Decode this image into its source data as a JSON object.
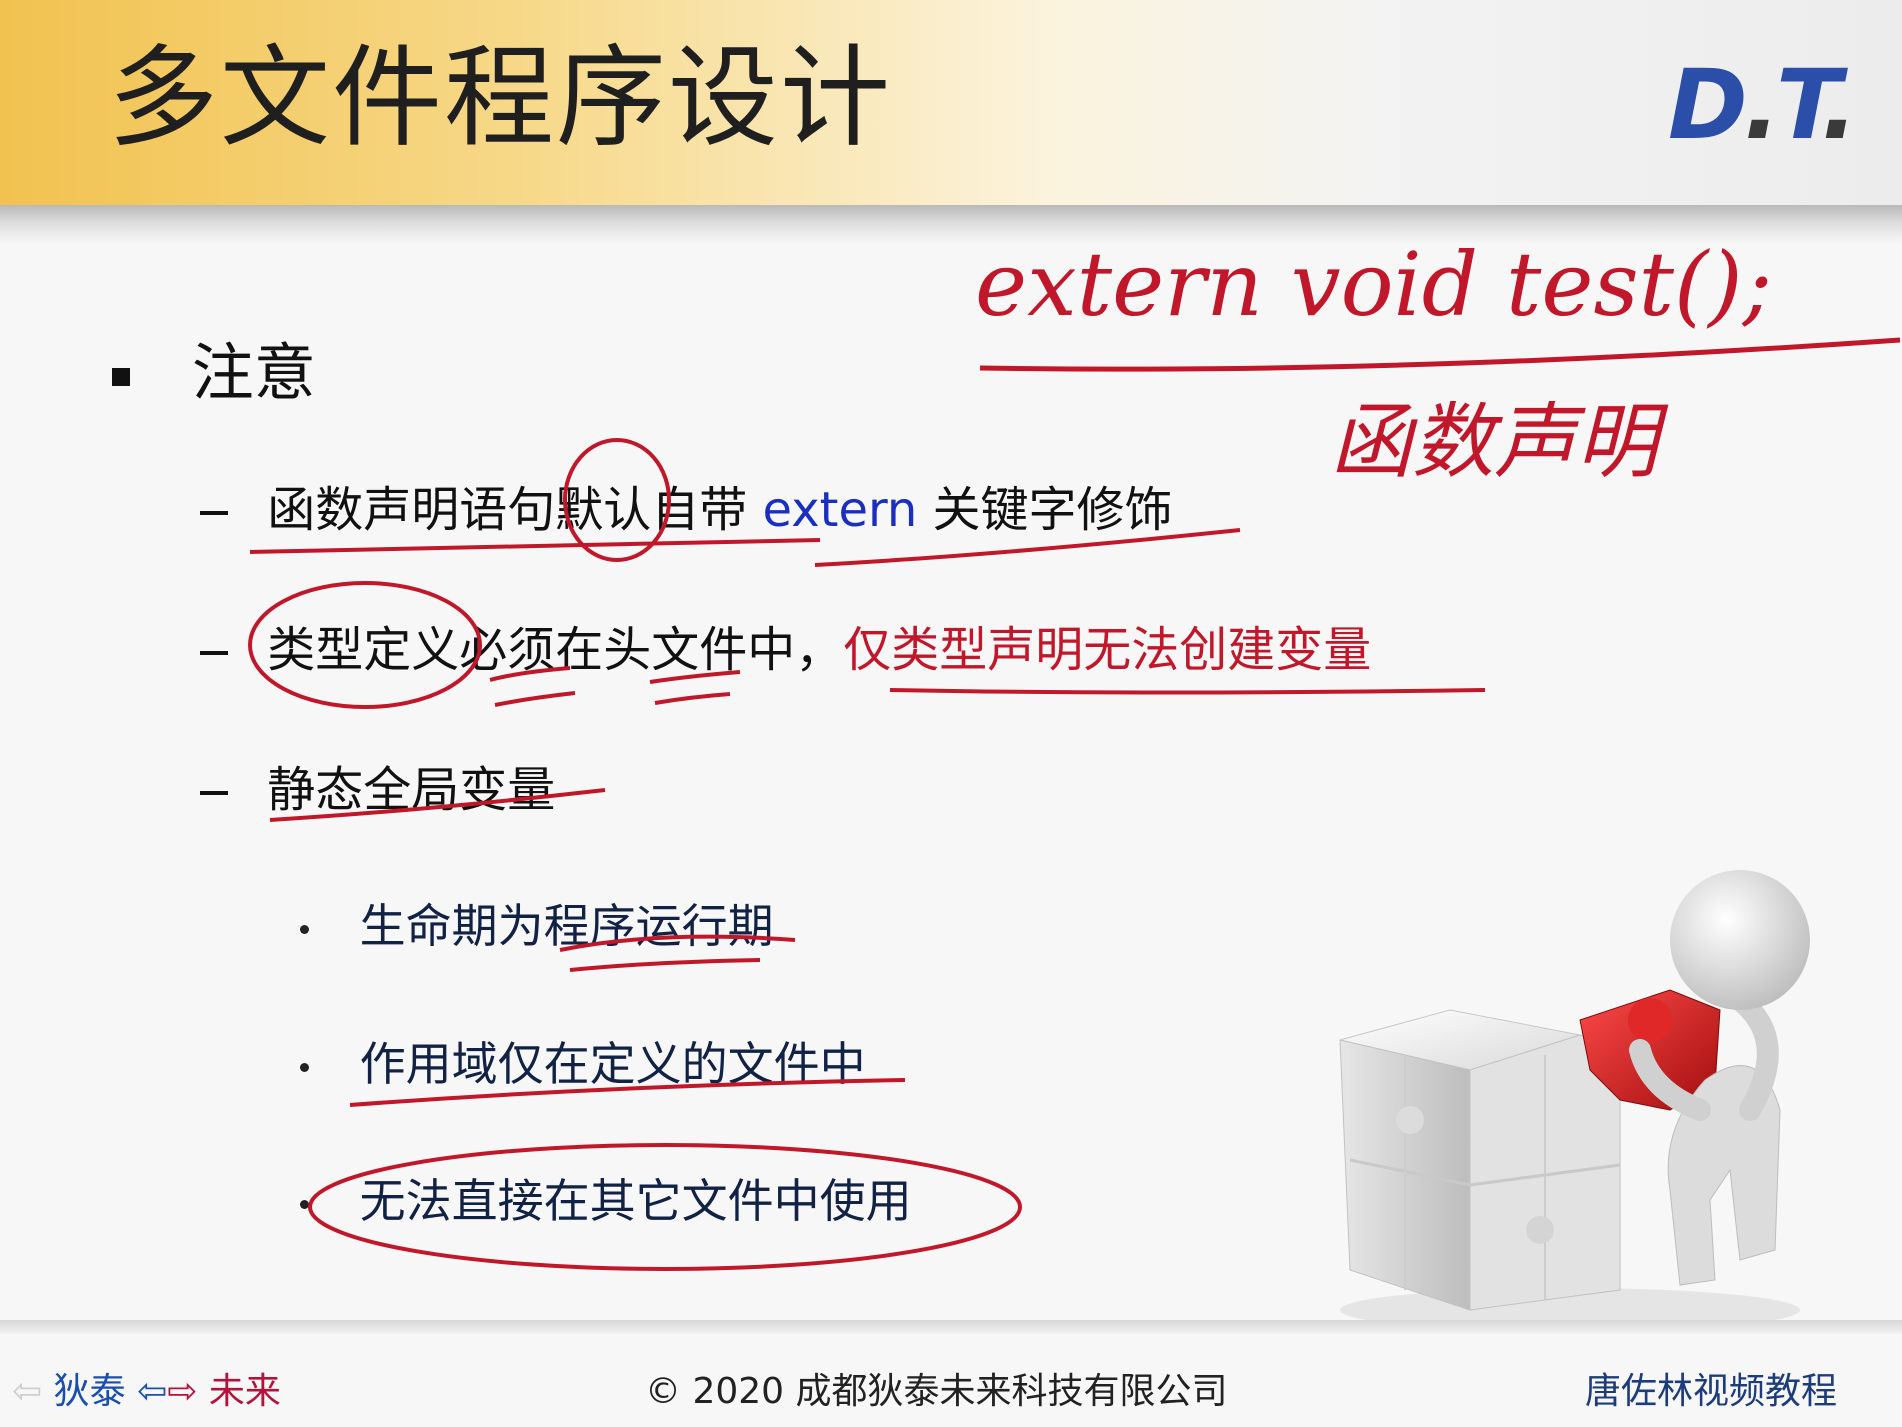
{
  "slide": {
    "title": "多文件程序设计",
    "logo": {
      "d": "D",
      "dot1": ".",
      "t": "T",
      "dot2": "."
    }
  },
  "bullets": {
    "level1": "注意",
    "items": [
      {
        "parts": [
          "函数声明语句默认自带 ",
          "extern",
          " 关键字修饰"
        ]
      },
      {
        "parts": [
          "类型定义必须在头文件中，",
          "仅类型声明无法创建变量"
        ]
      },
      {
        "parts": [
          "静态全局变量"
        ]
      }
    ],
    "sub_items": [
      "生命期为程序运行期",
      "作用域仅在定义的文件中",
      "无法直接在其它文件中使用"
    ]
  },
  "annotations": {
    "handwriting_line1": "extern void test();",
    "handwriting_line2": "函数声明"
  },
  "footer": {
    "left_a": "狄泰",
    "left_b": "未来",
    "center": "© 2020 成都狄泰未来科技有限公司",
    "right": "唐佐林视频教程"
  },
  "colors": {
    "ink_red": "#c0182a",
    "keyword_blue": "#1a2fbf",
    "header_gold": "#f1c24f",
    "logo_blue": "#2b4ea8"
  }
}
